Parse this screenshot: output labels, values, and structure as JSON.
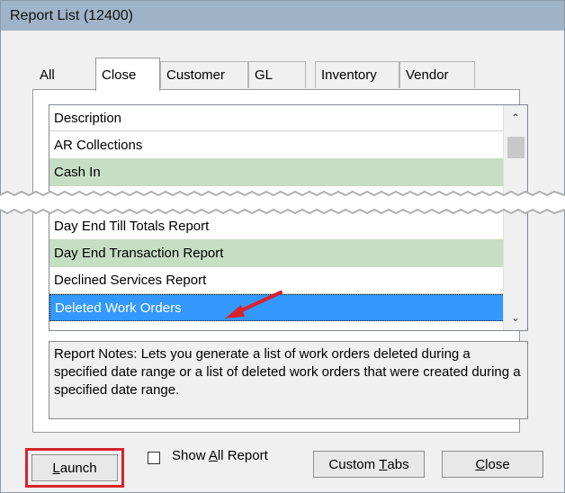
{
  "window": {
    "title": "Report List (12400)"
  },
  "tabs": [
    {
      "label": "All",
      "active": false
    },
    {
      "label": "Close",
      "active": true
    },
    {
      "label": "Customer",
      "active": false
    },
    {
      "label": "GL",
      "active": false
    },
    {
      "label": "Inventory",
      "active": false
    },
    {
      "label": "Vendor",
      "active": false
    }
  ],
  "list": {
    "header": "Description",
    "rows": [
      {
        "label": "AR Collections",
        "style": "white"
      },
      {
        "label": "Cash In",
        "style": "green"
      },
      {
        "label": "Day End Till Totals Report",
        "style": "white"
      },
      {
        "label": "Day End Transaction Report",
        "style": "green"
      },
      {
        "label": "Declined Services Report",
        "style": "white"
      },
      {
        "label": "Deleted Work Orders",
        "style": "selected"
      }
    ]
  },
  "notes": {
    "text": "Report Notes:  Lets you generate a list of work orders deleted during a specified date range or a list of deleted work orders that were created during a specified date range."
  },
  "buttons": {
    "launch_prefix": "",
    "launch_underline": "L",
    "launch_rest": "aunch",
    "show_all_prefix": "Show ",
    "show_all_underline": "A",
    "show_all_rest": "ll Report",
    "custom_tabs_prefix": "Custom ",
    "custom_tabs_underline": "T",
    "custom_tabs_rest": "abs",
    "close_underline": "C",
    "close_rest": "lose"
  },
  "colors": {
    "title_bar": "#9fb4c8",
    "row_green": "#c6dfc4",
    "selection": "#3399ff",
    "highlight_frame": "#d9222a",
    "annotation_arrow": "#d9222a"
  }
}
